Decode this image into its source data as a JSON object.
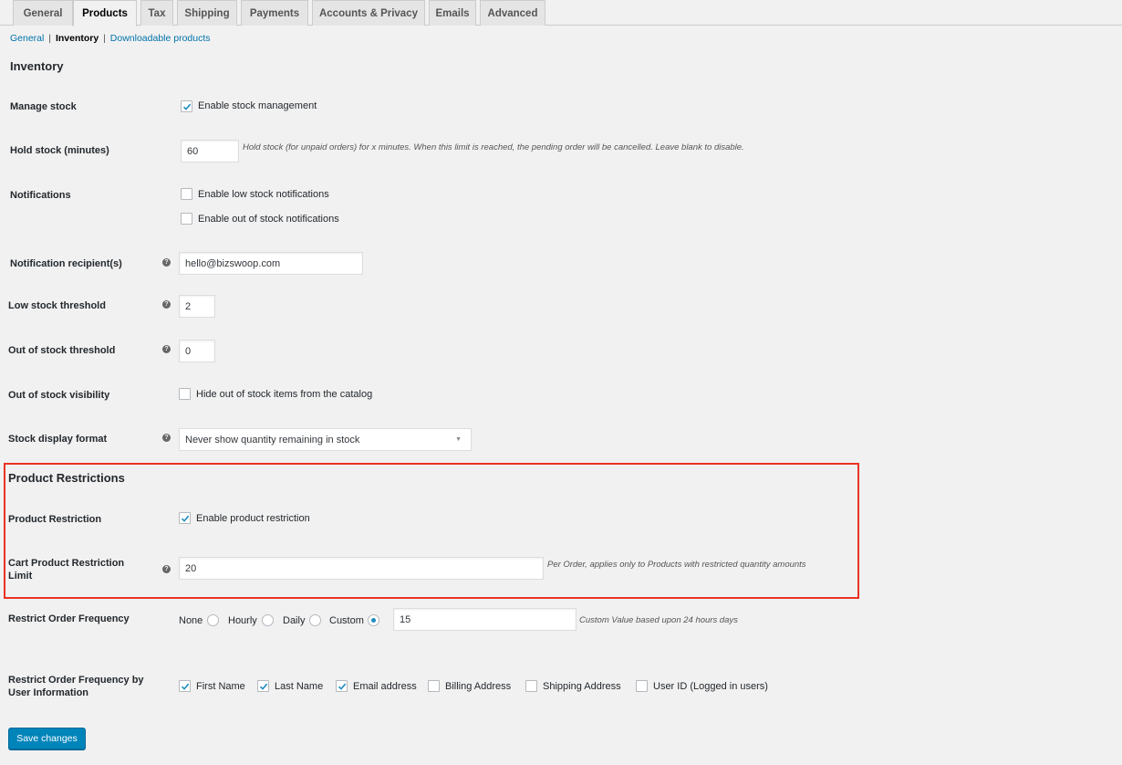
{
  "tabs": [
    "General",
    "Products",
    "Tax",
    "Shipping",
    "Payments",
    "Accounts & Privacy",
    "Emails",
    "Advanced"
  ],
  "active_tab": "Products",
  "subnav": {
    "general": "General",
    "inventory": "Inventory",
    "downloadable": "Downloadable products",
    "separator": "|"
  },
  "inventory": {
    "heading": "Inventory",
    "manage_stock": {
      "label": "Manage stock",
      "checkbox": "Enable stock management",
      "checked": true
    },
    "hold_stock": {
      "label": "Hold stock (minutes)",
      "value": "60",
      "description": "Hold stock (for unpaid orders) for x minutes. When this limit is reached, the pending order will be cancelled. Leave blank to disable."
    },
    "notifications": {
      "label": "Notifications",
      "low_stock": "Enable low stock notifications",
      "out_of_stock": "Enable out of stock notifications"
    },
    "recipient": {
      "label": "Notification recipient(s)",
      "value": "hello@bizswoop.com"
    },
    "low_threshold": {
      "label": "Low stock threshold",
      "value": "2"
    },
    "out_threshold": {
      "label": "Out of stock threshold",
      "value": "0"
    },
    "visibility": {
      "label": "Out of stock visibility",
      "checkbox": "Hide out of stock items from the catalog"
    },
    "display_format": {
      "label": "Stock display format",
      "value": "Never show quantity remaining in stock"
    }
  },
  "restrictions": {
    "heading": "Product Restrictions",
    "product_restriction": {
      "label": "Product Restriction",
      "checkbox": "Enable product restriction",
      "checked": true
    },
    "cart_limit": {
      "label_line1": "Cart Product Restriction",
      "label_line2": "Limit",
      "value": "20",
      "description": "Per Order, applies only to Products with restricted quantity amounts"
    }
  },
  "frequency": {
    "label": "Restrict Order Frequency",
    "options": [
      "None",
      "Hourly",
      "Daily",
      "Custom"
    ],
    "selected": "Custom",
    "custom_value": "15",
    "description": "Custom Value based upon 24 hours days"
  },
  "frequency_user": {
    "label_line1": "Restrict Order Frequency by",
    "label_line2": "User Information",
    "options": [
      {
        "label": "First Name",
        "checked": true
      },
      {
        "label": "Last Name",
        "checked": true
      },
      {
        "label": "Email address",
        "checked": true
      },
      {
        "label": "Billing Address",
        "checked": false
      },
      {
        "label": "Shipping Address",
        "checked": false
      },
      {
        "label": "User ID (Logged in users)",
        "checked": false
      }
    ]
  },
  "save_button": "Save changes",
  "icons": {
    "help": "question-mark-icon",
    "check": "checkmark-icon",
    "dropdown": "chevron-down-icon"
  },
  "colors": {
    "link": "#0073aa",
    "button": "#0085ba",
    "highlight_border": "#ea3323",
    "check": "#1e8cbe"
  }
}
